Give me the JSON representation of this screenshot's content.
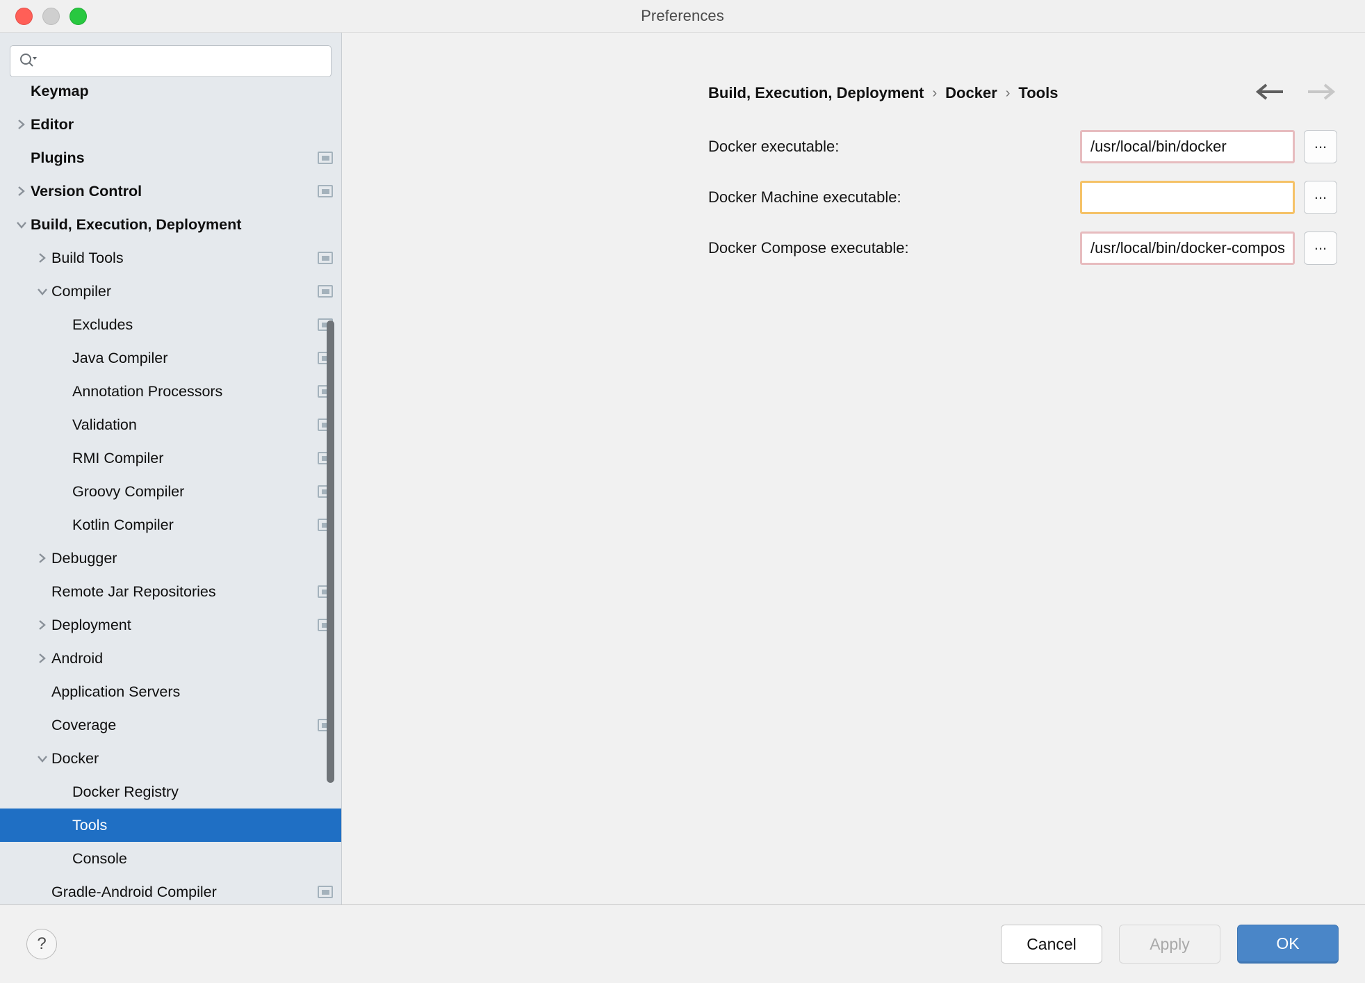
{
  "window": {
    "title": "Preferences",
    "traffic_lights": [
      "close-button",
      "minimize-button",
      "zoom-button"
    ]
  },
  "search": {
    "value": "",
    "placeholder": "",
    "icon": "search-icon"
  },
  "sidebar": {
    "items": [
      {
        "label": "Keymap",
        "depth": 0,
        "bold": true,
        "chevron": "none",
        "badge": false,
        "selected": false
      },
      {
        "label": "Editor",
        "depth": 0,
        "bold": true,
        "chevron": "right",
        "badge": false,
        "selected": false
      },
      {
        "label": "Plugins",
        "depth": 0,
        "bold": true,
        "chevron": "none",
        "badge": true,
        "selected": false
      },
      {
        "label": "Version Control",
        "depth": 0,
        "bold": true,
        "chevron": "right",
        "badge": true,
        "selected": false
      },
      {
        "label": "Build, Execution, Deployment",
        "depth": 0,
        "bold": true,
        "chevron": "down",
        "badge": false,
        "selected": false
      },
      {
        "label": "Build Tools",
        "depth": 1,
        "bold": false,
        "chevron": "right",
        "badge": true,
        "selected": false
      },
      {
        "label": "Compiler",
        "depth": 1,
        "bold": false,
        "chevron": "down",
        "badge": true,
        "selected": false
      },
      {
        "label": "Excludes",
        "depth": 2,
        "bold": false,
        "chevron": "none",
        "badge": true,
        "selected": false
      },
      {
        "label": "Java Compiler",
        "depth": 2,
        "bold": false,
        "chevron": "none",
        "badge": true,
        "selected": false
      },
      {
        "label": "Annotation Processors",
        "depth": 2,
        "bold": false,
        "chevron": "none",
        "badge": true,
        "selected": false
      },
      {
        "label": "Validation",
        "depth": 2,
        "bold": false,
        "chevron": "none",
        "badge": true,
        "selected": false
      },
      {
        "label": "RMI Compiler",
        "depth": 2,
        "bold": false,
        "chevron": "none",
        "badge": true,
        "selected": false
      },
      {
        "label": "Groovy Compiler",
        "depth": 2,
        "bold": false,
        "chevron": "none",
        "badge": true,
        "selected": false
      },
      {
        "label": "Kotlin Compiler",
        "depth": 2,
        "bold": false,
        "chevron": "none",
        "badge": true,
        "selected": false
      },
      {
        "label": "Debugger",
        "depth": 1,
        "bold": false,
        "chevron": "right",
        "badge": false,
        "selected": false
      },
      {
        "label": "Remote Jar Repositories",
        "depth": 1,
        "bold": false,
        "chevron": "none",
        "badge": true,
        "selected": false
      },
      {
        "label": "Deployment",
        "depth": 1,
        "bold": false,
        "chevron": "right",
        "badge": true,
        "selected": false
      },
      {
        "label": "Android",
        "depth": 1,
        "bold": false,
        "chevron": "right",
        "badge": false,
        "selected": false
      },
      {
        "label": "Application Servers",
        "depth": 1,
        "bold": false,
        "chevron": "none",
        "badge": false,
        "selected": false
      },
      {
        "label": "Coverage",
        "depth": 1,
        "bold": false,
        "chevron": "none",
        "badge": true,
        "selected": false
      },
      {
        "label": "Docker",
        "depth": 1,
        "bold": false,
        "chevron": "down",
        "badge": false,
        "selected": false
      },
      {
        "label": "Docker Registry",
        "depth": 2,
        "bold": false,
        "chevron": "none",
        "badge": false,
        "selected": false
      },
      {
        "label": "Tools",
        "depth": 2,
        "bold": false,
        "chevron": "none",
        "badge": false,
        "selected": true
      },
      {
        "label": "Console",
        "depth": 2,
        "bold": false,
        "chevron": "none",
        "badge": false,
        "selected": false
      },
      {
        "label": "Gradle-Android Compiler",
        "depth": 1,
        "bold": false,
        "chevron": "none",
        "badge": true,
        "selected": false
      }
    ],
    "selection_color": "#1f6fc4",
    "background_color": "#e5e9ed"
  },
  "breadcrumb": {
    "parts": [
      "Build, Execution, Deployment",
      "Docker",
      "Tools"
    ],
    "separator": "›"
  },
  "nav": {
    "back_label": "back-arrow",
    "forward_label": "forward-arrow",
    "back_enabled": true,
    "forward_enabled": false
  },
  "form": {
    "rows": [
      {
        "label": "Docker executable:",
        "value": "/usr/local/bin/docker",
        "placeholder": "",
        "state": "err",
        "browse_label": "..."
      },
      {
        "label": "Docker Machine executable:",
        "value": "",
        "placeholder": "",
        "state": "warn",
        "browse_label": "..."
      },
      {
        "label": "Docker Compose executable:",
        "value": "/usr/local/bin/docker-compose",
        "placeholder": "",
        "state": "err",
        "browse_label": "..."
      }
    ],
    "error_border_color": "#e7bcbf",
    "warning_border_color": "#f5c268"
  },
  "footer": {
    "help_label": "?",
    "cancel_label": "Cancel",
    "apply_label": "Apply",
    "apply_enabled": false,
    "ok_label": "OK",
    "ok_color": "#4a86c8"
  }
}
